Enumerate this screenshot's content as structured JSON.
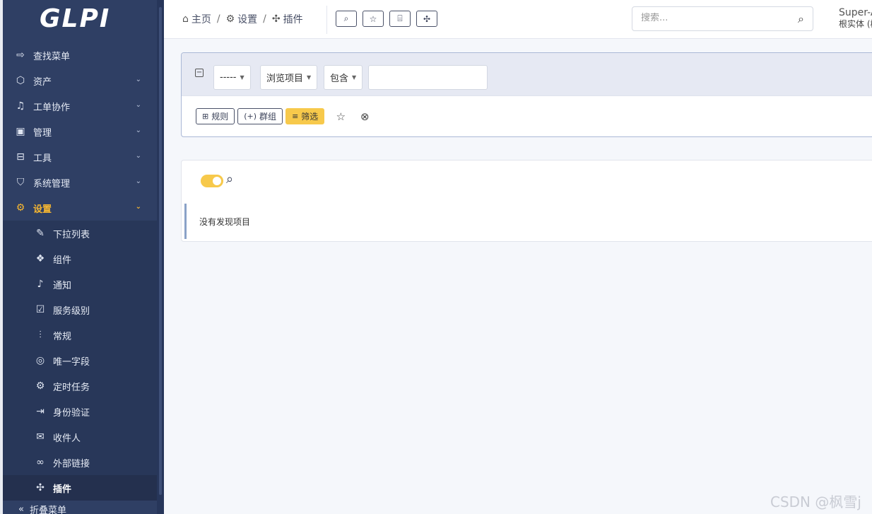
{
  "app": {
    "logo_text": "GLPI"
  },
  "sidebar": {
    "items": [
      {
        "label": "查找菜单",
        "icon": "arrow-right-icon",
        "glyph": "⇨",
        "expandable": false
      },
      {
        "label": "资产",
        "icon": "box-icon",
        "glyph": "⬡",
        "expandable": true
      },
      {
        "label": "工单协作",
        "icon": "headset-icon",
        "glyph": "♫",
        "expandable": true
      },
      {
        "label": "管理",
        "icon": "wallet-icon",
        "glyph": "▣",
        "expandable": true
      },
      {
        "label": "工具",
        "icon": "briefcase-icon",
        "glyph": "⊟",
        "expandable": true
      },
      {
        "label": "系统管理",
        "icon": "shield-icon",
        "glyph": "⛉",
        "expandable": true
      },
      {
        "label": "设置",
        "icon": "gear-icon",
        "glyph": "⚙",
        "expandable": true,
        "active": true
      }
    ],
    "subitems": [
      {
        "label": "下拉列表",
        "icon": "edit-icon",
        "glyph": "✎"
      },
      {
        "label": "组件",
        "icon": "components-icon",
        "glyph": "❖"
      },
      {
        "label": "通知",
        "icon": "bell-icon",
        "glyph": "♪"
      },
      {
        "label": "服务级别",
        "icon": "clipboard-check-icon",
        "glyph": "☑"
      },
      {
        "label": "常规",
        "icon": "adjustments-icon",
        "glyph": "⫶"
      },
      {
        "label": "唯一字段",
        "icon": "fingerprint-icon",
        "glyph": "◎"
      },
      {
        "label": "定时任务",
        "icon": "settings-automation-icon",
        "glyph": "⚙"
      },
      {
        "label": "身份验证",
        "icon": "login-icon",
        "glyph": "⇥"
      },
      {
        "label": "收件人",
        "icon": "inbox-icon",
        "glyph": "✉"
      },
      {
        "label": "外部链接",
        "icon": "link-icon",
        "glyph": "∞"
      },
      {
        "label": "插件",
        "icon": "puzzle-icon",
        "glyph": "✣",
        "current": true
      }
    ],
    "collapse_label": "折叠菜单"
  },
  "header": {
    "breadcrumbs": [
      {
        "label": "主页",
        "icon": "home-icon",
        "glyph": "⌂"
      },
      {
        "label": "设置",
        "icon": "gear-icon",
        "glyph": "⚙"
      },
      {
        "label": "插件",
        "icon": "puzzle-icon",
        "glyph": "✣"
      }
    ],
    "breadcrumb_sep": "/",
    "buttons": [
      {
        "icon": "search-icon",
        "glyph": "⌕"
      },
      {
        "icon": "star-icon",
        "glyph": "☆"
      },
      {
        "icon": "marketplace-icon",
        "glyph": "⌸"
      },
      {
        "icon": "puzzle-icon",
        "glyph": "✣"
      }
    ],
    "search_placeholder": "搜索...",
    "user_name": "Super-A",
    "user_entity": "根实体 (树"
  },
  "filter": {
    "field_select": "-----",
    "item_select": "浏览项目",
    "op_select": "包含",
    "value": "",
    "rule_label": "规则",
    "group_label": "群组",
    "filter_label": "筛选"
  },
  "results": {
    "empty_text": "没有发现项目"
  },
  "watermark": "CSDN @枫雪j"
}
